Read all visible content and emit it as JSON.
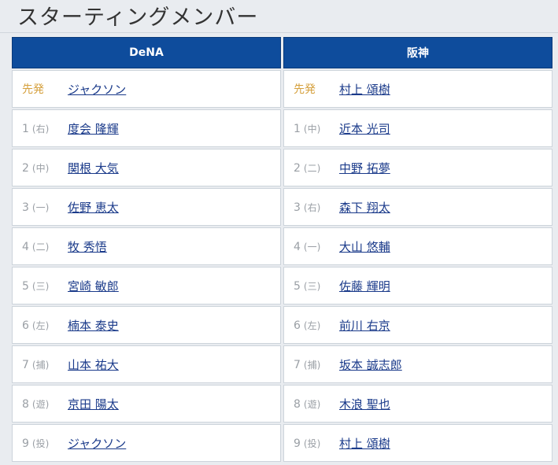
{
  "page": {
    "title": "スターティングメンバー"
  },
  "teams": [
    {
      "name": "DeNA",
      "starter_label": "先発",
      "starter": "ジャクソン",
      "lineup": [
        {
          "order": "1",
          "pos": "(右)",
          "player": "度会 隆輝"
        },
        {
          "order": "2",
          "pos": "(中)",
          "player": "関根 大気"
        },
        {
          "order": "3",
          "pos": "(一)",
          "player": "佐野 恵太"
        },
        {
          "order": "4",
          "pos": "(二)",
          "player": "牧 秀悟"
        },
        {
          "order": "5",
          "pos": "(三)",
          "player": "宮崎 敏郎"
        },
        {
          "order": "6",
          "pos": "(左)",
          "player": "楠本 泰史"
        },
        {
          "order": "7",
          "pos": "(捕)",
          "player": "山本 祐大"
        },
        {
          "order": "8",
          "pos": "(遊)",
          "player": "京田 陽太"
        },
        {
          "order": "9",
          "pos": "(投)",
          "player": "ジャクソン"
        }
      ]
    },
    {
      "name": "阪神",
      "starter_label": "先発",
      "starter": "村上 頌樹",
      "lineup": [
        {
          "order": "1",
          "pos": "(中)",
          "player": "近本 光司"
        },
        {
          "order": "2",
          "pos": "(二)",
          "player": "中野 拓夢"
        },
        {
          "order": "3",
          "pos": "(右)",
          "player": "森下 翔太"
        },
        {
          "order": "4",
          "pos": "(一)",
          "player": "大山 悠輔"
        },
        {
          "order": "5",
          "pos": "(三)",
          "player": "佐藤 輝明"
        },
        {
          "order": "6",
          "pos": "(左)",
          "player": "前川 右京"
        },
        {
          "order": "7",
          "pos": "(捕)",
          "player": "坂本 誠志郎"
        },
        {
          "order": "8",
          "pos": "(遊)",
          "player": "木浪 聖也"
        },
        {
          "order": "9",
          "pos": "(投)",
          "player": "村上 頌樹"
        }
      ]
    }
  ],
  "colors": {
    "header_bg": "#0e4c9c",
    "starter_label": "#d5a03d",
    "link": "#1a3a8a"
  }
}
